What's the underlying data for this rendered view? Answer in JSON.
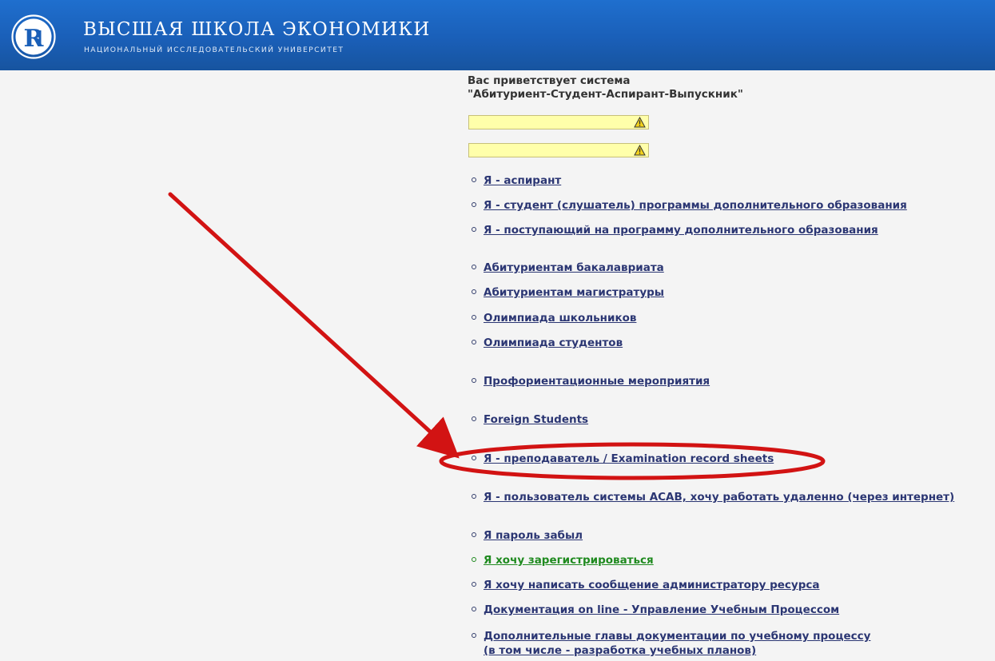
{
  "header": {
    "title": "ВЫСШАЯ ШКОЛА ЭКОНОМИКИ",
    "subtitle": "НАЦИОНАЛЬНЫЙ ИССЛЕДОВАТЕЛЬСКИЙ УНИВЕРСИТЕТ",
    "logo_icon": "hse-logo-icon",
    "bg_color": "#1a5fb8"
  },
  "welcome": {
    "line1": "Вас приветствует система",
    "line2": "\"Абитуриент-Студент-Аспирант-Выпускник\""
  },
  "warnings": {
    "icon": "warning-triangle-icon",
    "field1": "",
    "field2": ""
  },
  "links": [
    "Я - аспирант",
    "Я - студент (слушатель) программы дополнительного образования",
    "Я - поступающий на программу дополнительного образования",
    "Абитуриентам бакалавриата",
    "Абитуриентам магистратуры",
    "Олимпиада школьников",
    "Олимпиада студентов",
    "Профориентационные мероприятия",
    "Foreign Students",
    "Я - преподаватель / Examination record sheets",
    "Я - пользователь системы АСАВ, хочу работать удаленно (через интернет)",
    "Я пароль забыл",
    "Я хочу зарегистрироваться",
    "Я хочу написать сообщение администратору ресурса",
    "Документация on line - Управление Учебным Процессом",
    "Дополнительные главы документации по учебному процессу"
  ],
  "links_extra": {
    "doc_chapters_line2": "(в том числе - разработка учебных планов)"
  },
  "annotation": {
    "color": "#d21313",
    "arrow_icon": "red-arrow-annotation",
    "ellipse_icon": "red-ellipse-annotation"
  }
}
